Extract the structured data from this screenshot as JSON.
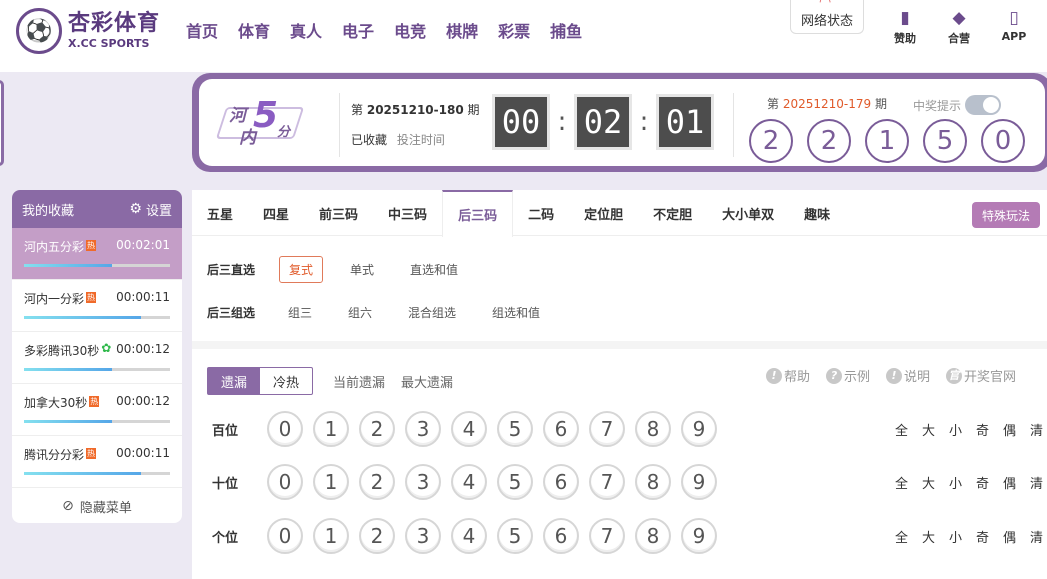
{
  "brand": {
    "logo_cn": "杏彩体育",
    "logo_en": "X.CC SPORTS"
  },
  "nav": [
    {
      "label": "首页"
    },
    {
      "label": "体育"
    },
    {
      "label": "真人"
    },
    {
      "label": "电子"
    },
    {
      "label": "电竞"
    },
    {
      "label": "棋牌"
    },
    {
      "label": "彩票"
    },
    {
      "label": "捕鱼"
    }
  ],
  "header": {
    "network_status": "网络状态",
    "help": "赞助",
    "partner": "合营",
    "app": "APP"
  },
  "game": {
    "logo_text": [
      "河",
      "内",
      "5",
      "分"
    ],
    "current_issue_prefix": "第",
    "current_issue": "20251210-180",
    "current_issue_suffix": "期",
    "favorited": "已收藏",
    "bet_time": "投注时间",
    "countdown": [
      "00",
      "02",
      "01"
    ],
    "prev_issue_prefix": "第",
    "prev_issue": "20251210-179",
    "prev_issue_suffix": "期",
    "prize_hint": "中奖提示",
    "results": [
      "2",
      "2",
      "1",
      "5",
      "0"
    ]
  },
  "favorites": {
    "title": "我的收藏",
    "settings": "设置",
    "hide_menu": "隐藏菜单",
    "items": [
      {
        "name": "河内五分彩",
        "badge": "热",
        "time": "00:02:01",
        "progress": 0.6
      },
      {
        "name": "河内一分彩",
        "badge": "热",
        "time": "00:00:11",
        "progress": 0.8
      },
      {
        "name": "多彩腾讯30秒",
        "badge": "✿",
        "time": "00:00:12",
        "progress": 0.6
      },
      {
        "name": "加拿大30秒",
        "badge": "热",
        "time": "00:00:12",
        "progress": 0.6
      },
      {
        "name": "腾讯分分彩",
        "badge": "热",
        "time": "00:00:11",
        "progress": 0.8
      }
    ]
  },
  "tabs": [
    {
      "label": "五星"
    },
    {
      "label": "四星"
    },
    {
      "label": "前三码"
    },
    {
      "label": "中三码"
    },
    {
      "label": "后三码"
    },
    {
      "label": "二码"
    },
    {
      "label": "定位胆"
    },
    {
      "label": "不定胆"
    },
    {
      "label": "大小单双"
    },
    {
      "label": "趣味"
    }
  ],
  "special_play": "特殊玩法",
  "sub_direct": {
    "label": "后三直选",
    "options": [
      "复式",
      "单式",
      "直选和值"
    ]
  },
  "sub_group": {
    "label": "后三组选",
    "options": [
      "组三",
      "组六",
      "混合组选",
      "组选和值"
    ]
  },
  "miss": {
    "seg_on": "遗漏",
    "seg_off": "冷热",
    "current": "当前遗漏",
    "max": "最大遗漏"
  },
  "help_links": [
    "帮助",
    "示例",
    "说明",
    "开奖官网"
  ],
  "positions": [
    {
      "label": "百位"
    },
    {
      "label": "十位"
    },
    {
      "label": "个位"
    }
  ],
  "digits": [
    "0",
    "1",
    "2",
    "3",
    "4",
    "5",
    "6",
    "7",
    "8",
    "9"
  ],
  "quick_select": [
    "全",
    "大",
    "小",
    "奇",
    "偶",
    "清"
  ]
}
